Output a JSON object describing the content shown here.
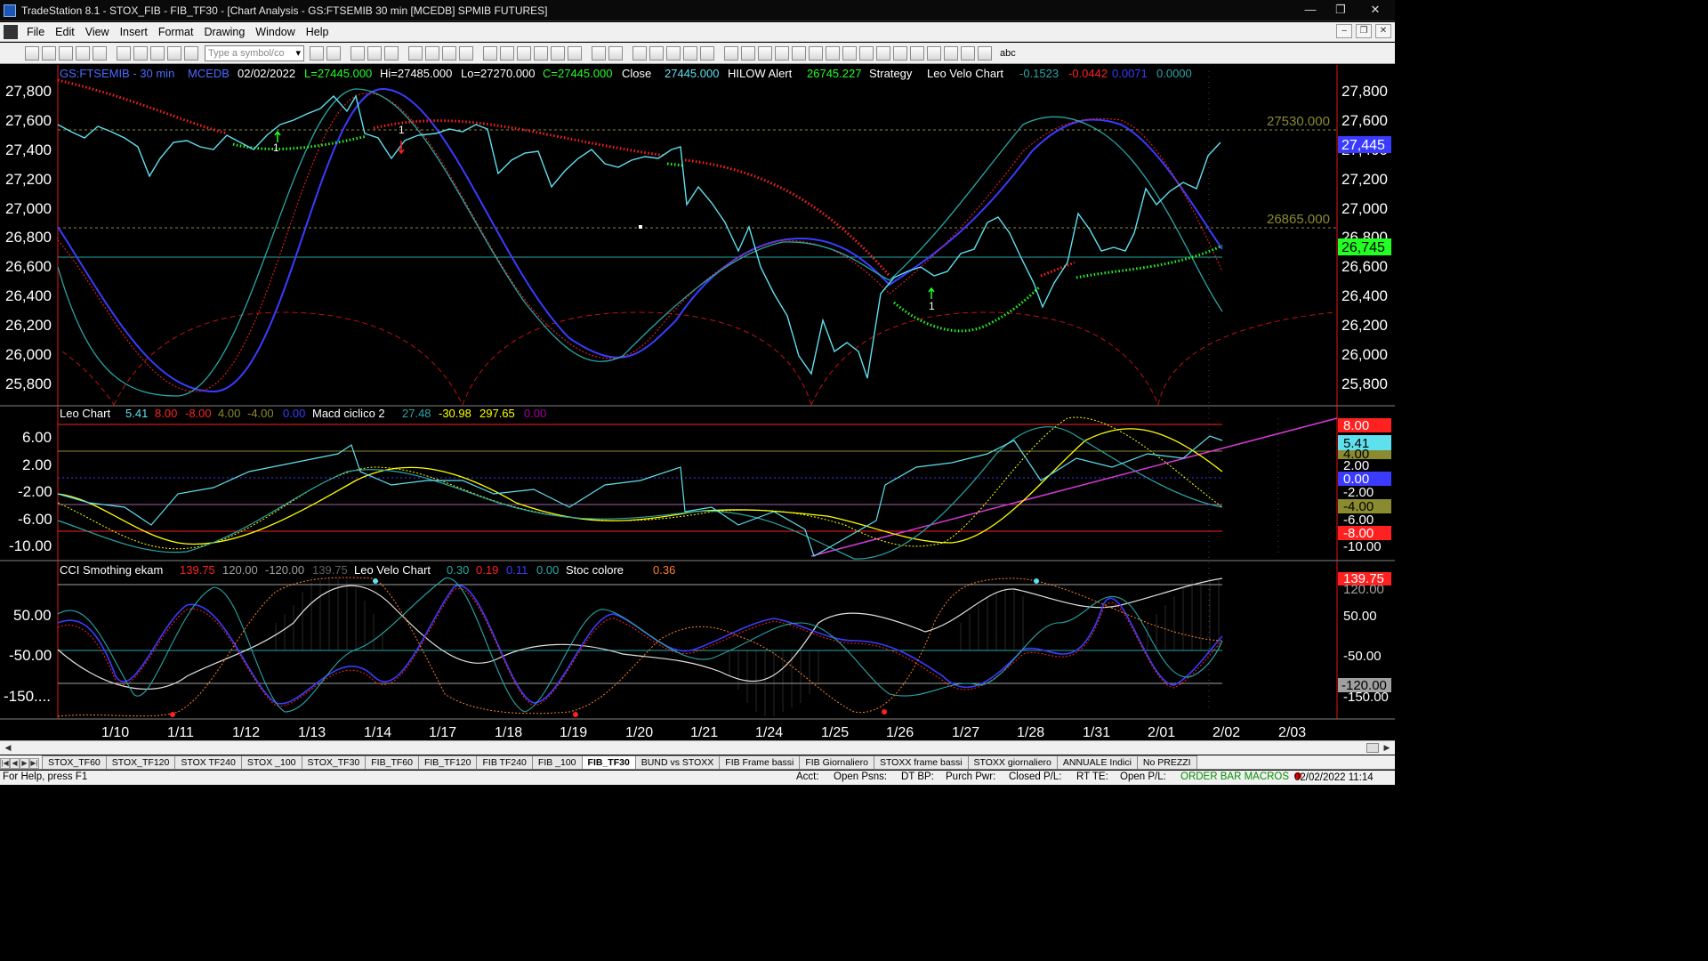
{
  "window": {
    "title": "TradeStation 8.1 - STOX_FIB - FIB_TF30 - [Chart Analysis - GS:FTSEMIB  30 min  [MCEDB] SPMIB FUTURES]",
    "minimize": "—",
    "restore": "❐",
    "close": "✕"
  },
  "menu": [
    "File",
    "Edit",
    "View",
    "Insert",
    "Format",
    "Drawing",
    "Window",
    "Help"
  ],
  "toolbar": {
    "symbol_placeholder": "Type a symbol/co",
    "abc_label": "abc"
  },
  "chart": {
    "header": {
      "symbol": "GS:FTSEMIB - 30 min",
      "feed": "MCEDB",
      "date": "02/02/2022",
      "last": "L=27445.000",
      "high": "Hi=27485.000",
      "low": "Lo=27270.000",
      "close_eq": "C=27445.000",
      "close_label": "Close",
      "close_value": "27445.000",
      "hilow_label": "HILOW Alert",
      "hilow_value": "26745.227",
      "strategy_label": "Strategy",
      "velo_label": "Leo Velo Chart",
      "v1": "-0.1523",
      "v2": "-0.0442",
      "v3": "0.0071",
      "v4": "0.0000"
    },
    "price_axis": [
      "27,800",
      "27,600",
      "27,400",
      "27,200",
      "27,000",
      "26,800",
      "26,600",
      "26,400",
      "26,200",
      "26,000",
      "25,800"
    ],
    "level_labels": {
      "hi": "27530.000",
      "lo": "26865.000"
    },
    "badges": {
      "last": "27,445",
      "hilow": "26,745"
    },
    "signal_labels": [
      "1",
      "1",
      "1"
    ],
    "sub1": {
      "title": "Leo Chart",
      "v1": "5.41",
      "v2": "8.00",
      "v3": "-8.00",
      "v4": "4.00",
      "v5": "-4.00",
      "v6": "0.00",
      "macd_title": "Macd ciclico 2",
      "m1": "27.48",
      "m2": "-30.98",
      "m3": "297.65",
      "m4": "0.00",
      "axis": [
        "6.00",
        "2.00",
        "-2.00",
        "-6.00",
        "-10.00"
      ],
      "badges": [
        "8.00",
        "5.41",
        "4.00",
        "2.00",
        "0.00",
        "-2.00",
        "-4.00",
        "-6.00",
        "-8.00",
        "-10.00"
      ]
    },
    "sub2": {
      "title": "CCI Smothing ekam",
      "c1": "139.75",
      "c2": "120.00",
      "c3": "-120.00",
      "c4": "139.75",
      "velo_title": "Leo Velo Chart",
      "l1": "0.30",
      "l2": "0.19",
      "l3": "0.11",
      "l4": "0.00",
      "stoc_title": "Stoc colore",
      "s1": "0.36",
      "axis": [
        "50.00",
        "-50.00",
        "-150...."
      ],
      "badges": [
        "139.75",
        "120.00",
        "50.00",
        "-50.00",
        "-120.00",
        "-150.00"
      ]
    },
    "date_axis": [
      "1/10",
      "1/11",
      "1/12",
      "1/13",
      "1/14",
      "1/17",
      "1/18",
      "1/19",
      "1/20",
      "1/21",
      "1/24",
      "1/25",
      "1/26",
      "1/27",
      "1/28",
      "1/31",
      "2/01",
      "2/02",
      "2/03"
    ]
  },
  "chart_data": {
    "type": "line",
    "title": "GS:FTSEMIB - 30 min",
    "x": [
      "1/10",
      "1/11",
      "1/12",
      "1/13",
      "1/14",
      "1/17",
      "1/18",
      "1/19",
      "1/20",
      "1/21",
      "1/24",
      "1/25",
      "1/26",
      "1/27",
      "1/28",
      "1/31",
      "2/01",
      "2/02"
    ],
    "series": [
      {
        "name": "Close",
        "values": [
          27500,
          27420,
          27450,
          27700,
          27400,
          27500,
          27300,
          27350,
          27380,
          27000,
          26200,
          25950,
          26500,
          26700,
          26400,
          26900,
          27100,
          27445
        ]
      },
      {
        "name": "HILOW Alert",
        "values": [
          27800,
          27650,
          27500,
          27550,
          27580,
          27600,
          27550,
          27500,
          27450,
          27300,
          26900,
          26600,
          26300,
          26200,
          26400,
          26600,
          26650,
          26745
        ]
      }
    ],
    "ylim": [
      25700,
      27900
    ],
    "levels": [
      27530,
      26865,
      26665
    ]
  },
  "tabs": [
    "STOX_TF60",
    "STOX_TF120",
    "STOX TF240",
    "STOX _100",
    "STOX_TF30",
    "FIB_TF60",
    "FIB_TF120",
    "FIB TF240",
    "FIB _100",
    "FIB_TF30",
    "BUND vs STOXX",
    "FIB Frame bassi",
    "FIB Giornaliero",
    "STOXX frame bassi",
    "STOXX giornaliero",
    "ANNUALE Indici",
    "No PREZZI"
  ],
  "active_tab": "FIB_TF30",
  "status": {
    "help": "For Help, press F1",
    "acct": "Acct:",
    "open_psns": "Open Psns:",
    "dt_bp": "DT BP:",
    "purch_pwr": "Purch Pwr:",
    "closed_pl": "Closed P/L:",
    "rt_te": "RT TE:",
    "open_pl": "Open P/L:",
    "macros": "ORDER BAR  MACROS",
    "datetime": "02/02/2022 11:14"
  },
  "colors": {
    "bg": "#000000",
    "price": "#5fe0ee",
    "hilow_red": "#ff2020",
    "hilow_green": "#22ff22",
    "level": "#8a8a30",
    "magenta": "#d63ad6"
  }
}
